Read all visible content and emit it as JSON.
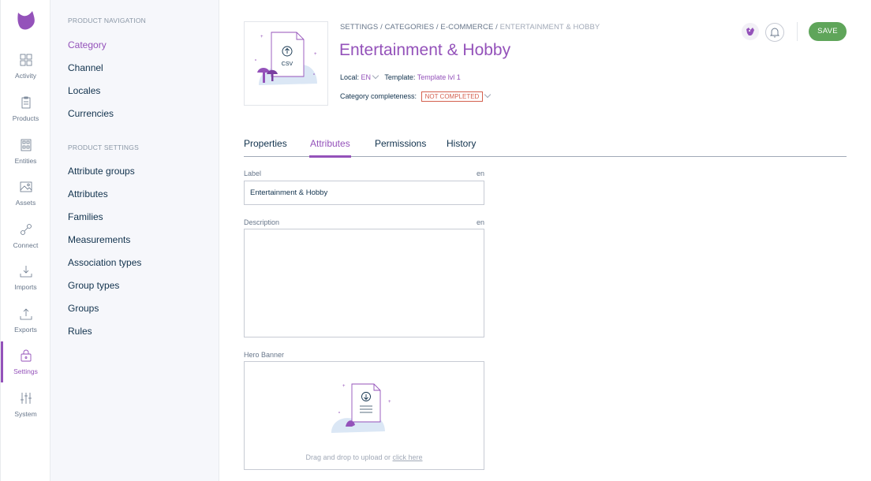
{
  "rail": {
    "items": [
      {
        "label": "Activity",
        "icon": "activity-icon"
      },
      {
        "label": "Products",
        "icon": "products-icon"
      },
      {
        "label": "Entities",
        "icon": "entities-icon"
      },
      {
        "label": "Assets",
        "icon": "assets-icon"
      },
      {
        "label": "Connect",
        "icon": "connect-icon"
      },
      {
        "label": "Imports",
        "icon": "imports-icon"
      },
      {
        "label": "Exports",
        "icon": "exports-icon"
      },
      {
        "label": "Settings",
        "icon": "settings-icon"
      },
      {
        "label": "System",
        "icon": "system-icon"
      }
    ],
    "active": "Settings"
  },
  "subnav": {
    "product_navigation_title": "PRODUCT NAVIGATION",
    "product_navigation": [
      "Category",
      "Channel",
      "Locales",
      "Currencies"
    ],
    "product_settings_title": "PRODUCT SETTINGS",
    "product_settings": [
      "Attribute groups",
      "Attributes",
      "Families",
      "Measurements",
      "Association types",
      "Group types",
      "Groups",
      "Rules"
    ],
    "active": "Category"
  },
  "header": {
    "breadcrumb": [
      "SETTINGS",
      "CATEGORIES",
      "E-COMMERCE",
      "ENTERTAINMENT & HOBBY"
    ],
    "breadcrumb_sep": "/",
    "title": "Entertainment & Hobby",
    "local_label": "Local:",
    "local_value": "EN",
    "template_label": "Template:",
    "template_value": "Template lvl 1",
    "completeness_label": "Category completeness:",
    "completeness_value": "NOT COMPLETED",
    "save_label": "SAVE",
    "thumb_text": "CSV"
  },
  "tabs": [
    "Properties",
    "Attributes",
    "Permissions",
    "History"
  ],
  "active_tab": "Attributes",
  "form": {
    "label_title": "Label",
    "label_locale": "en",
    "label_value": "Entertainment & Hobby",
    "description_title": "Description",
    "description_locale": "en",
    "description_value": "",
    "hero_title": "Hero Banner",
    "dropzone_text": "Drag and drop to upload or ",
    "dropzone_link": "click here"
  },
  "colors": {
    "accent": "#9452ba",
    "save": "#5fa55a",
    "badge": "#d4604f"
  }
}
